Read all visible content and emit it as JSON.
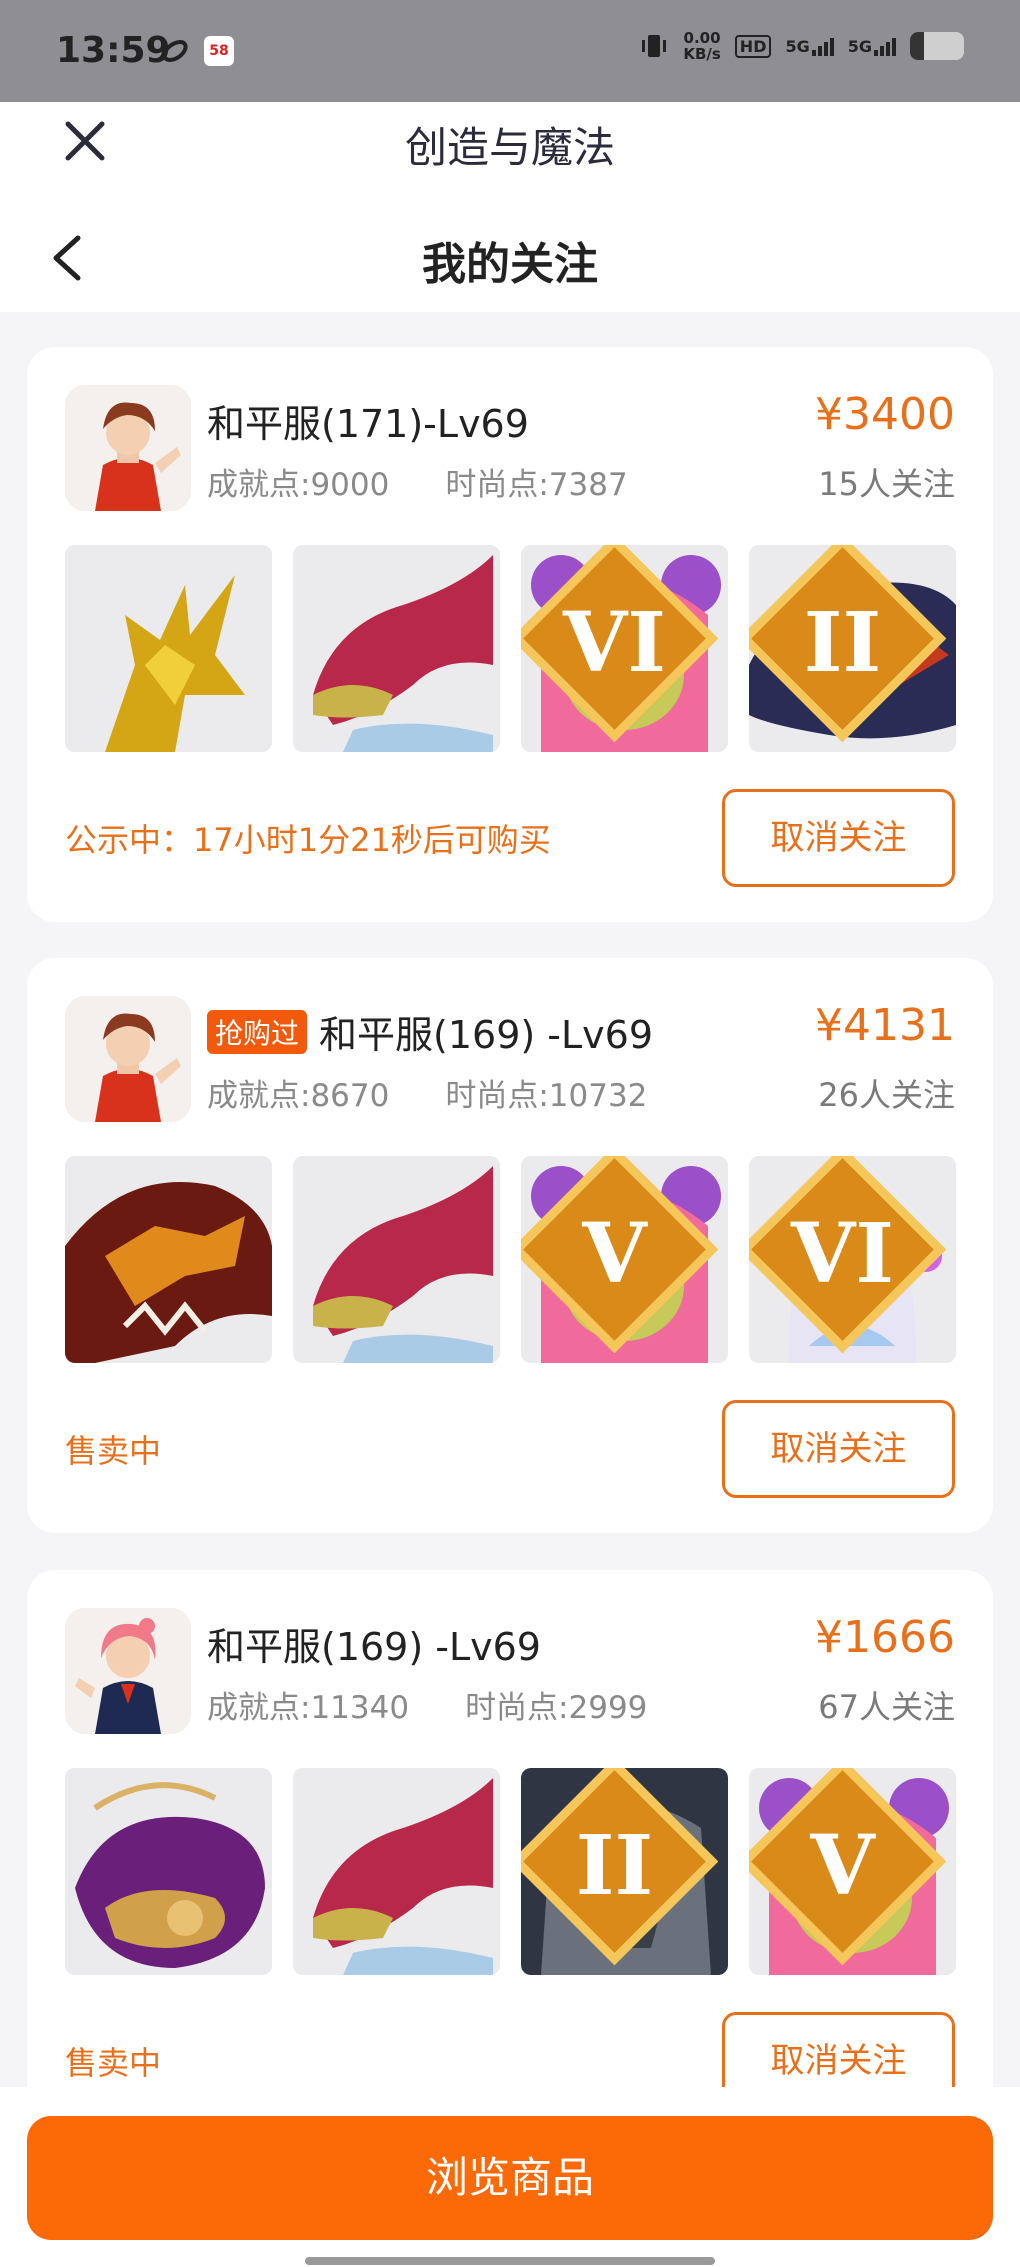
{
  "status_bar": {
    "time": "13:59",
    "app_badge": "58",
    "net_speed_value": "0.00",
    "net_speed_unit": "KB/s",
    "hd": "HD",
    "sim1": "5G",
    "sim2": "5G"
  },
  "header": {
    "app_title": "创造与魔法",
    "page_title": "我的关注"
  },
  "cards": [
    {
      "tag": "",
      "server": "和平服(171)-Lv69",
      "achievement": "成就点:9000",
      "fashion": "时尚点:7387",
      "price": "¥3400",
      "followers": "15人关注",
      "status": "公示中：17小时1分21秒后可购买",
      "unfollow_label": "取消关注",
      "thumbs": [
        {
          "icon": "golden-dragon-icon",
          "badge": ""
        },
        {
          "icon": "crimson-dragon-icon",
          "badge": ""
        },
        {
          "icon": "pink-bear-icon",
          "badge": "VI"
        },
        {
          "icon": "dark-dragon-icon",
          "badge": "II"
        }
      ]
    },
    {
      "tag": "抢购过",
      "server": "和平服(169) -Lv69",
      "achievement": "成就点:8670",
      "fashion": "时尚点:10732",
      "price": "¥4131",
      "followers": "26人关注",
      "status": "售卖中",
      "unfollow_label": "取消关注",
      "thumbs": [
        {
          "icon": "fire-dragon-icon",
          "badge": ""
        },
        {
          "icon": "crimson-dragon-icon",
          "badge": ""
        },
        {
          "icon": "pink-bear-icon",
          "badge": "V"
        },
        {
          "icon": "spirit-girl-icon",
          "badge": "VI"
        }
      ]
    },
    {
      "tag": "",
      "server": "和平服(169) -Lv69",
      "achievement": "成就点:11340",
      "fashion": "时尚点:2999",
      "price": "¥1666",
      "followers": "67人关注",
      "status": "售卖中",
      "unfollow_label": "取消关注",
      "thumbs": [
        {
          "icon": "cosmic-whale-icon",
          "badge": ""
        },
        {
          "icon": "crimson-dragon-icon",
          "badge": ""
        },
        {
          "icon": "stone-golem-icon",
          "badge": "II"
        },
        {
          "icon": "pink-bear-icon",
          "badge": "V"
        }
      ]
    }
  ],
  "footer": {
    "browse_label": "浏览商品"
  },
  "colors": {
    "accent": "#e8701a",
    "button": "#fb6a06",
    "tag": "#f05a0a"
  }
}
